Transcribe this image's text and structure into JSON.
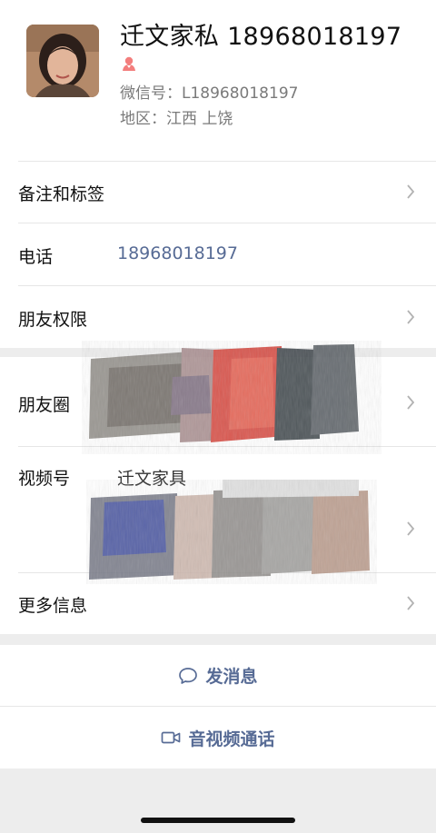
{
  "profile": {
    "name": "迁文家私 18968018197",
    "wechat_id": "微信号：L18968018197",
    "region": "地区：江西 上饶"
  },
  "rows": {
    "remark": {
      "label": "备注和标签"
    },
    "phone": {
      "label": "电话",
      "value": "18968018197"
    },
    "permissions": {
      "label": "朋友权限"
    },
    "moments": {
      "label": "朋友圈"
    },
    "channels": {
      "label": "视频号",
      "value": "迁文家具"
    },
    "more": {
      "label": "更多信息"
    }
  },
  "actions": {
    "message": "发消息",
    "call": "音视频通话"
  },
  "colors": {
    "link": "#576b95",
    "background": "#ededed",
    "gender_female": "#f37e7d"
  }
}
